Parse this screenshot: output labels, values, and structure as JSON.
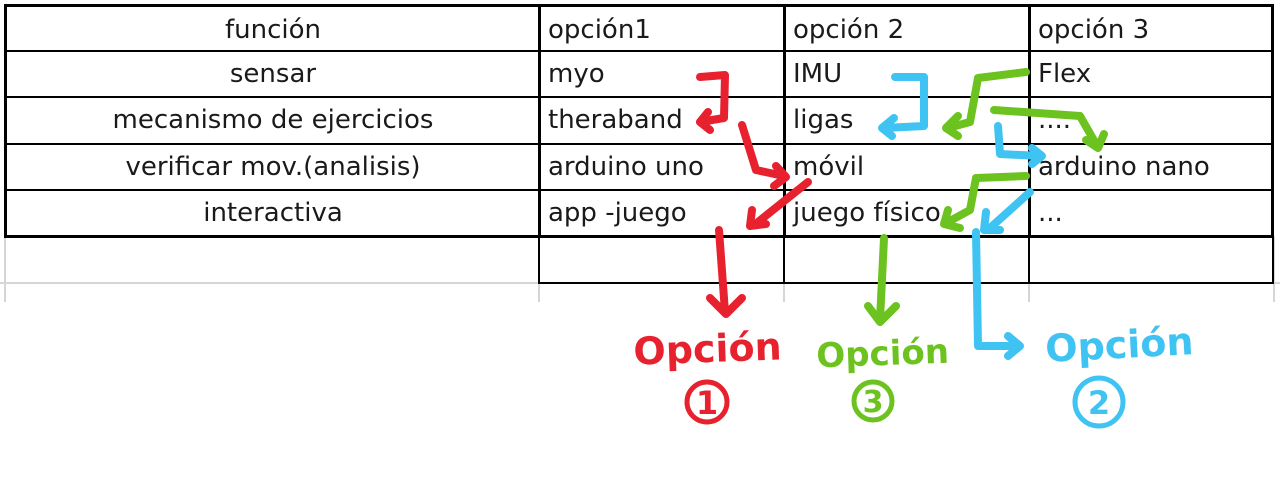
{
  "table": {
    "rows": [
      [
        "función",
        "opción1",
        "opción 2",
        "opción 3"
      ],
      [
        "sensar",
        "myo",
        "IMU",
        "Flex"
      ],
      [
        "mecanismo de ejercicios",
        "theraband",
        "ligas",
        "...."
      ],
      [
        "verificar mov.(analisis)",
        "arduino uno",
        "móvil",
        "arduino nano"
      ],
      [
        "interactiva",
        "app -juego",
        "juego físico",
        "..."
      ],
      [
        "",
        "",
        "",
        ""
      ]
    ]
  },
  "annotations": {
    "option1": {
      "label": "Opción",
      "number": "1",
      "color": "#e8212f"
    },
    "option2": {
      "label": "Opción",
      "number": "2",
      "color": "#3ec3f2"
    },
    "option3": {
      "label": "Opción",
      "number": "3",
      "color": "#6cc21e"
    }
  }
}
